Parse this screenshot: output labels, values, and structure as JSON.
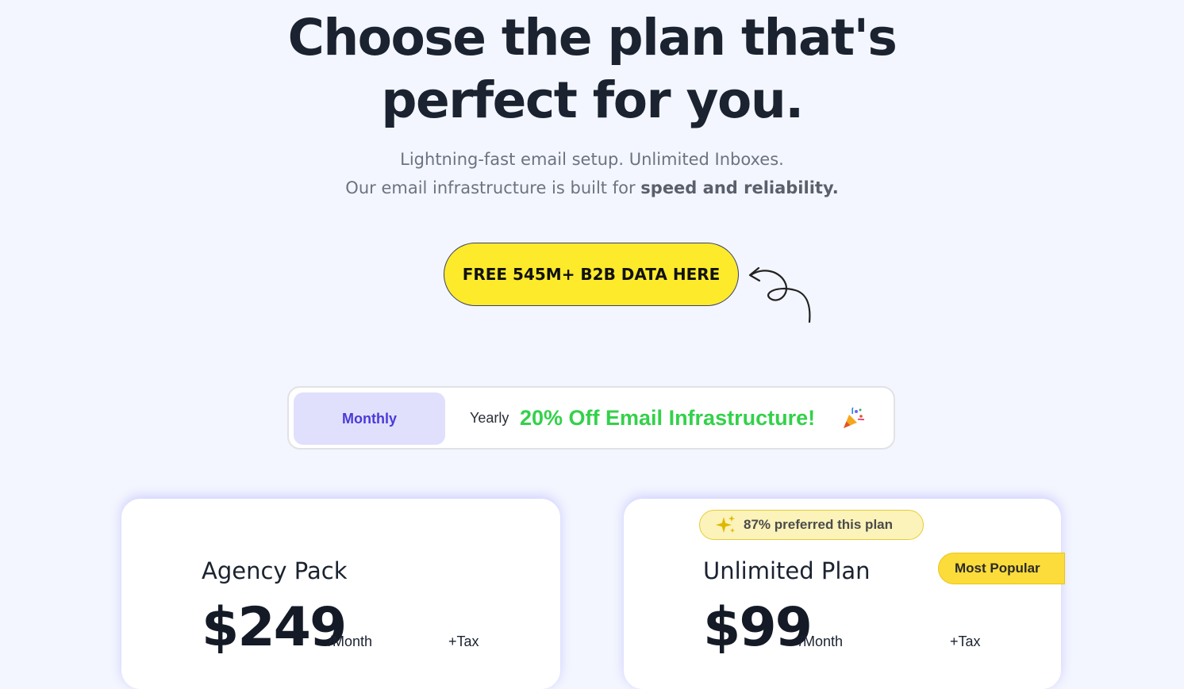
{
  "hero": {
    "headline_line1": "Choose the plan that's",
    "headline_line2": "perfect for you.",
    "sub_line1": "Lightning-fast email setup. Unlimited Inboxes.",
    "sub_line2_prefix": "Our email infrastructure is built for ",
    "sub_line2_bold": "speed and reliability."
  },
  "cta": {
    "label": "FREE 545M+ B2B DATA HERE",
    "color": "#fdea2b"
  },
  "billing_toggle": {
    "monthly_label": "Monthly",
    "yearly_label": "Yearly",
    "promo": "20% Off Email Infrastructure!",
    "selected": "Monthly",
    "promo_color": "#33d14a"
  },
  "plans": [
    {
      "name": "Agency Pack",
      "price": "$249",
      "period": "/Month",
      "tax": "+Tax"
    },
    {
      "name": "Unlimited Plan",
      "price": "$99",
      "period": "/Month",
      "tax": "+Tax",
      "badge_preferred": "87% preferred this plan",
      "badge_popular": "Most Popular"
    }
  ],
  "icons": [
    "curly-arrow-icon",
    "party-popper-icon",
    "sparkle-icon"
  ]
}
